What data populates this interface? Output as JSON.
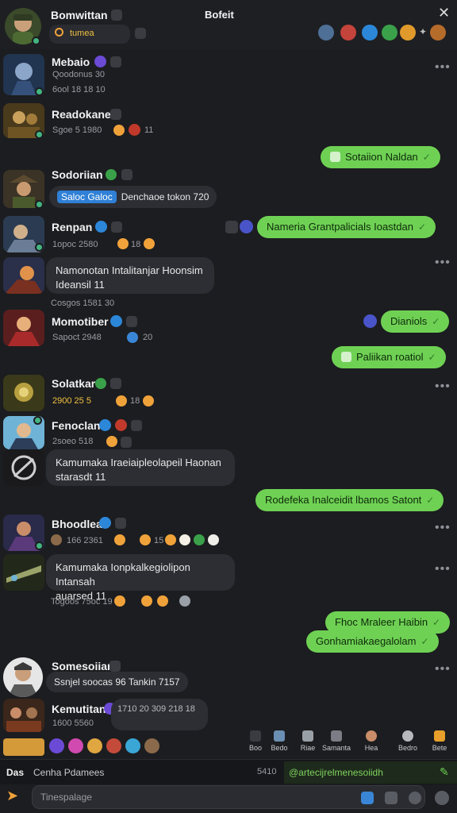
{
  "header": {
    "title": "Bomwittan",
    "center_title": "Bofeit",
    "search_placeholder": "tumea",
    "close_symbol": "✕",
    "icons": [
      "pin-icon",
      "game-icon",
      "app-icon",
      "status-icon",
      "profile-icon",
      "gift-icon",
      "avatar-icon"
    ]
  },
  "threads": [
    {
      "name": "Mebaio",
      "sub": "Qoodonus 30",
      "meta": "6ool 18 18 10"
    },
    {
      "name": "Readokane",
      "sub": "Sgoe 5 1980",
      "meta": "11"
    },
    {
      "name": "Sodoriian",
      "sub": "Denchaoe tokon 720",
      "pill": "Saloc Galoc"
    },
    {
      "name": "Renpan",
      "sub": "1opoc 2580",
      "meta": "18"
    },
    {
      "name": "Momotiber",
      "sub": "Sapoct 2948",
      "meta": "20"
    },
    {
      "name": "Solatkar",
      "sub": "2900 25 5",
      "meta": "18"
    },
    {
      "name": "Fenoclan",
      "sub": "2soeo 518"
    },
    {
      "name": "Bhoodlea",
      "sub": "166 2361",
      "meta": "15"
    },
    {
      "name": "Somesoiian",
      "sub": "Ssnjel soocas 96 Tankin 7157"
    },
    {
      "name": "Kemutitan",
      "sub": "1600 5560",
      "meta": "1710 20 309 218 18"
    }
  ],
  "incoming_bubbles": [
    {
      "text": "Namonotan Intalitanjar Hoonsim\nIdeansil 11"
    },
    {
      "text": "Kamumaka Iraeiaipleolapeil Haonan\nstarasdt 11"
    },
    {
      "text": "Kamumaka Ionpkalkegiolipon Intansah\nauarsed 11"
    }
  ],
  "outgoing_bubbles": [
    {
      "text": "Sotaiion Naldan"
    },
    {
      "text": "Nameria Grantpalicials Ioastdan"
    },
    {
      "text": "Dianiols"
    },
    {
      "text": "Paliikan roatiol"
    },
    {
      "text": "Rodefeka Inalceidit lbamos Satont"
    },
    {
      "text": "Fhoc Mraleer Haibin"
    },
    {
      "text": "Gonhamiakaegalolam"
    }
  ],
  "timestamps": [
    "Cosgos 1581 30",
    "Togoos 75oc 19"
  ],
  "tabs": [
    {
      "label": "Boo"
    },
    {
      "label": "Bedo"
    },
    {
      "label": "Riae"
    },
    {
      "label": "Samanta"
    },
    {
      "label": "Hea"
    },
    {
      "label": "Bedro"
    },
    {
      "label": "Bete"
    }
  ],
  "status": {
    "left": "Cenha Pdamees",
    "prefix": "Das",
    "count": "5410",
    "link": "@artecijrelmenesoiidh"
  },
  "composer": {
    "placeholder": "Tinespalage"
  },
  "colors": {
    "accent_green": "#6fd154",
    "bubble_in": "#2d2e33",
    "background": "#1c1d20",
    "online": "#43b581"
  }
}
